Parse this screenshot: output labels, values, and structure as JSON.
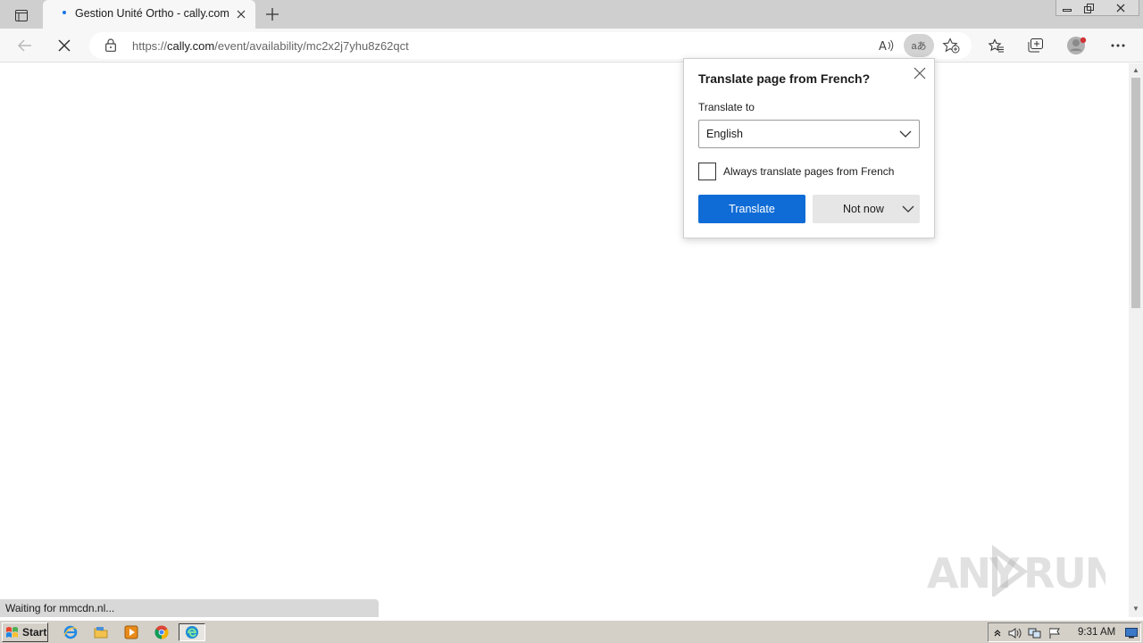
{
  "browser": {
    "tab": {
      "title": "Gestion Unité Ortho - cally.com"
    },
    "address": {
      "url_scheme": "https://",
      "url_host": "cally.com",
      "url_path": "/event/availability/mc2x2j7yhu8z62qct"
    },
    "translate_icon_text": "aあ"
  },
  "translate_popup": {
    "title": "Translate page from French?",
    "translate_to_label": "Translate to",
    "selected_language": "English",
    "always_label": "Always translate pages from French",
    "always_checked": false,
    "translate_button": "Translate",
    "not_now_button": "Not now",
    "accent_color": "#0f6cd6"
  },
  "status_bar": {
    "text": "Waiting for mmcdn.nl..."
  },
  "watermark": {
    "text": "ANY RUN"
  },
  "taskbar": {
    "start_label": "Start",
    "clock": "9:31 AM",
    "quick_launch": [
      "internet-explorer-icon",
      "folder-icon",
      "media-player-icon",
      "chrome-icon",
      "edge-icon"
    ]
  }
}
